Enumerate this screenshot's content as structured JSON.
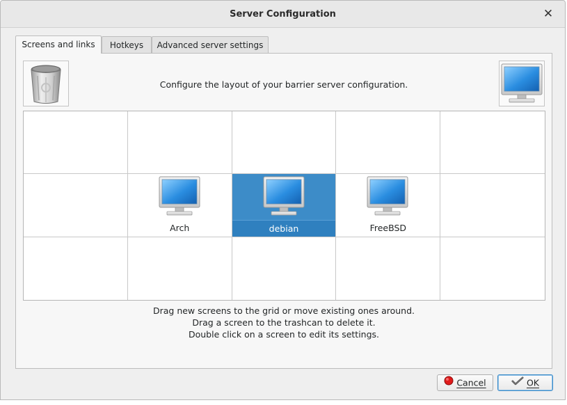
{
  "window": {
    "title": "Server Configuration"
  },
  "tabs": [
    {
      "label": "Screens and links",
      "active": true
    },
    {
      "label": "Hotkeys",
      "active": false
    },
    {
      "label": "Advanced server settings",
      "active": false
    }
  ],
  "panel": {
    "description": "Configure the layout of your barrier server configuration.",
    "hints": [
      "Drag new screens to the grid or move existing ones around.",
      "Drag a screen to the trashcan to delete it.",
      "Double click on a screen to edit its settings."
    ]
  },
  "grid": {
    "columns": 5,
    "rows": 3,
    "screens": [
      {
        "name": "Arch",
        "row": 1,
        "col": 1,
        "selected": false
      },
      {
        "name": "debian",
        "row": 1,
        "col": 2,
        "selected": true
      },
      {
        "name": "FreeBSD",
        "row": 1,
        "col": 3,
        "selected": false
      }
    ]
  },
  "buttons": {
    "cancel": {
      "label": "Cancel",
      "icon": "cancel-icon"
    },
    "ok": {
      "label": "OK",
      "icon": "ok-icon"
    }
  },
  "colors": {
    "selection": "#3d8cc8",
    "monitor_screen": "#2a8de0"
  }
}
